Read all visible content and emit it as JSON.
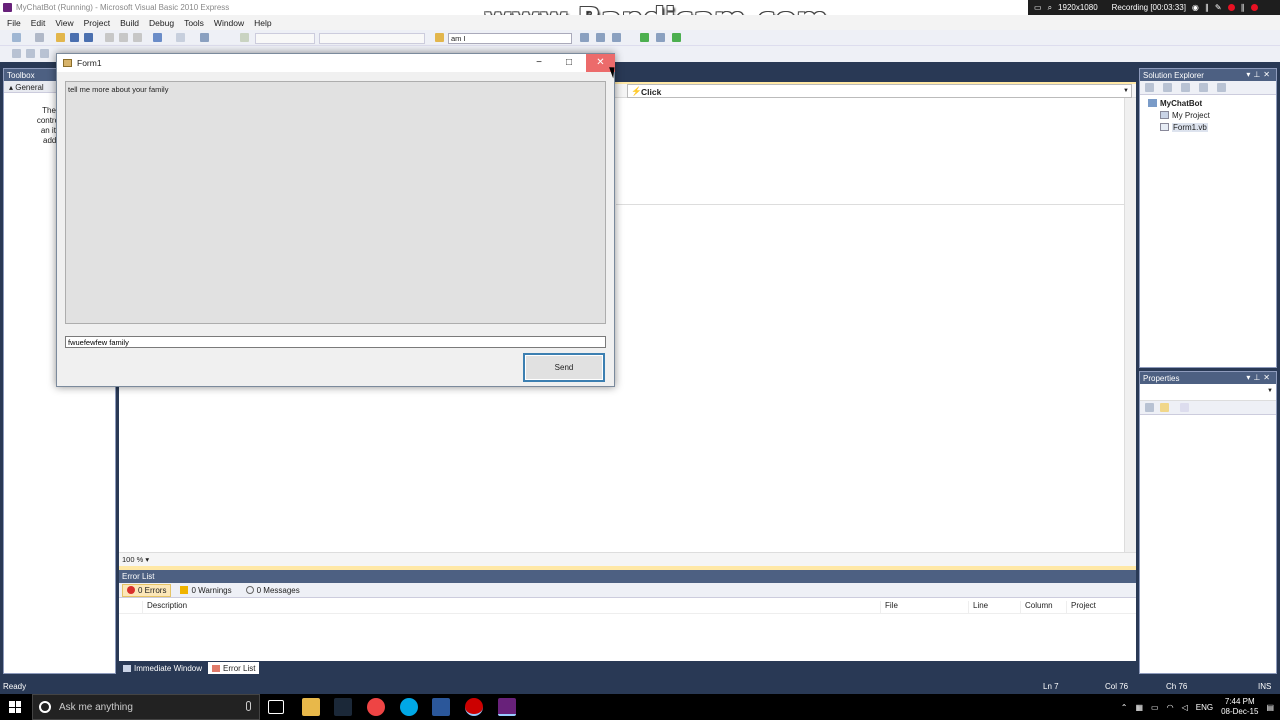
{
  "titlebar": {
    "title": "MyChatBot (Running) - Microsoft Visual Basic 2010 Express"
  },
  "recorder": {
    "resolution": "1920x1080",
    "status": "Recording [00:03:33]"
  },
  "watermark": "www.Bandicam.com",
  "menu": [
    "File",
    "Edit",
    "View",
    "Project",
    "Build",
    "Debug",
    "Tools",
    "Window",
    "Help"
  ],
  "toolbar": {
    "find_value": "am I"
  },
  "toolbox": {
    "title": "Toolbox",
    "group": "General",
    "message_lines": [
      "There are",
      "controls in th",
      "an item on",
      "add it to t"
    ]
  },
  "editor": {
    "event_combo": "Click",
    "zoom": "100 %"
  },
  "error_list": {
    "title": "Error List",
    "errors": "0 Errors",
    "warnings": "0 Warnings",
    "messages": "0 Messages",
    "columns": [
      "Description",
      "File",
      "Line",
      "Column",
      "Project"
    ]
  },
  "bottom_tabs": [
    "Immediate Window",
    "Error List"
  ],
  "solution_explorer": {
    "title": "Solution Explorer",
    "items": [
      "MyChatBot",
      "My Project",
      "Form1.vb"
    ]
  },
  "properties": {
    "title": "Properties"
  },
  "statusbar": {
    "left": "Ready",
    "ln": "Ln 7",
    "col": "Col 76",
    "ch": "Ch 76",
    "mode": "INS"
  },
  "form1": {
    "title": "Form1",
    "chat_text": "tell me more about your family",
    "input_value": "fwuefewfew family",
    "send_label": "Send"
  },
  "taskbar": {
    "search_placeholder": "Ask me anything",
    "lang": "ENG",
    "time": "7:44 PM",
    "date": "08-Dec-15"
  }
}
